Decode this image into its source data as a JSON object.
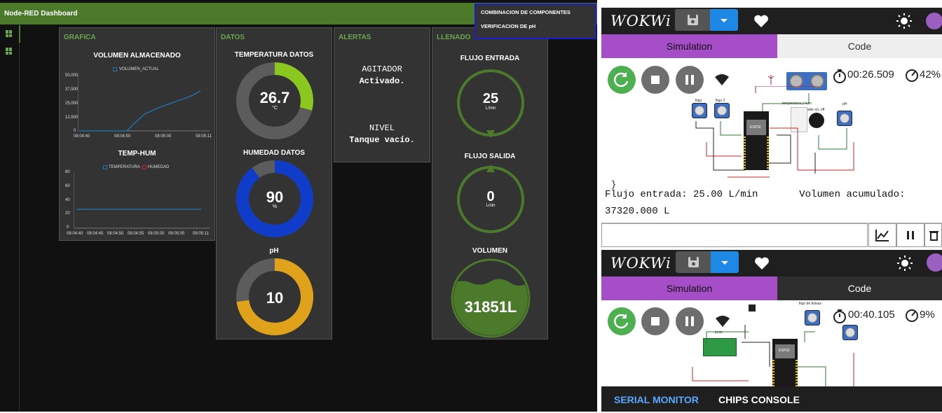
{
  "nodered": {
    "title": "Node-RED Dashboard",
    "menu": [
      "COMBINACION DE COMPONENTES",
      "VERIFICACION DE pH"
    ],
    "grafica": {
      "group_title": "GRAFICA",
      "chart1": {
        "title": "VOLUMEN ALMACENADO",
        "legend": "VOLUMEN_ACTUAL",
        "yticks": [
          "50,000",
          "37,500",
          "25,000",
          "12,500",
          "0"
        ],
        "xticks": [
          "08:04:40",
          "08:04:50",
          "08:05:00",
          "08:05:11"
        ]
      },
      "chart2": {
        "title": "TEMP-HUM",
        "legend": [
          "TEMPERATURA",
          "HUMEDAD"
        ],
        "yticks": [
          "80",
          "60",
          "40",
          "20",
          "0"
        ],
        "xticks": [
          "08:04:40",
          "08:04:45",
          "08:04:50",
          "08:04:55",
          "08:05:00",
          "08:05:05",
          "08:05:11"
        ]
      }
    },
    "datos": {
      "group_title": "DATOS",
      "temp": {
        "title": "TEMPERATURA DATOS",
        "value": "26.7",
        "unit": "°C"
      },
      "hum": {
        "title": "HUMEDAD DATOS",
        "value": "90",
        "unit": "%"
      },
      "ph": {
        "title": "pH",
        "value": "10"
      }
    },
    "alertas": {
      "group_title": "ALERTAS",
      "a1_label": "AGITADOR",
      "a1_value": "Activado.",
      "a2_label": "NIVEL",
      "a2_value": "Tanque vacío."
    },
    "llenado": {
      "group_title": "LLENADO",
      "in": {
        "title": "FLUJO ENTRADA",
        "value": "25",
        "unit": "L/min"
      },
      "out": {
        "title": "FLUJO SALIDA",
        "value": "0",
        "unit": "Lmin"
      },
      "vol": {
        "title": "VOLUMEN",
        "value": "31851L"
      }
    }
  },
  "wokwi1": {
    "logo": "WOKWi",
    "tab_sim": "Simulation",
    "tab_code": "Code",
    "timer": "00:26.509",
    "speed": "42%",
    "code_tail": "}",
    "serial_line1": "Flujo entrada: 25.00 L/min       Volumen acumulado:",
    "serial_line2": "37320.000 L",
    "labels": {
      "flujo": "flujo",
      "flujo2": "flujo 2",
      "temp": "temperatura y hum",
      "agit": "agitador on, off",
      "ph": "pH",
      "esp": "ESP32"
    }
  },
  "wokwi2": {
    "logo": "WOKWi",
    "tab_sim": "Simulation",
    "tab_code": "Code",
    "timer": "00:40.105",
    "speed": "9%",
    "serial_tab": "SERIAL MONITOR",
    "chips_tab": "CHIPS CONSOLE",
    "labels": {
      "peso": "peso",
      "bolsas": "flujo de bolsas",
      "esp": "ESP32"
    }
  },
  "colors": {
    "green": "#4b7a2b",
    "lime": "#8bc81f",
    "blue": "#0f3cc9",
    "orange": "#e0a21a",
    "purple": "#a64dc8",
    "wokwi_blue": "#1e88e5"
  }
}
